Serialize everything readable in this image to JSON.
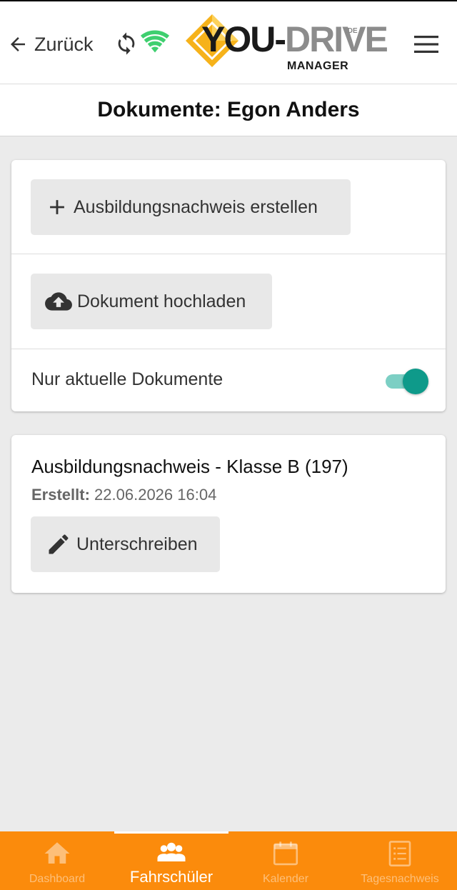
{
  "header": {
    "back_label": "Zurück",
    "logo": {
      "text_you": "YOU-",
      "text_drive": "DRIVE",
      "text_de": ".DE",
      "text_manager": "MANAGER"
    },
    "icons": [
      "arrow-left-icon",
      "sync-icon",
      "wifi-icon",
      "hamburger-menu-icon"
    ]
  },
  "title": "Dokumente: Egon Anders",
  "actions": {
    "create_label": "Ausbildungsnachweis erstellen",
    "upload_label": "Dokument hochladen",
    "toggle_label": "Nur aktuelle Dokumente",
    "toggle_on": true
  },
  "documents": [
    {
      "title": "Ausbildungsnachweis - Klasse B (197)",
      "created_label": "Erstellt:",
      "created_value": "22.06.2026 16:04",
      "sign_label": "Unterschreiben"
    }
  ],
  "bottom_nav": [
    {
      "label": "Dashboard",
      "icon": "home-icon",
      "active": false
    },
    {
      "label": "Fahrschüler",
      "icon": "students-icon",
      "active": true
    },
    {
      "label": "Kalender",
      "icon": "calendar-icon",
      "active": false
    },
    {
      "label": "Tagesnachweis",
      "icon": "list-icon",
      "active": false
    }
  ],
  "colors": {
    "nav_background": "#fb8b0c",
    "toggle_on": "#0e9a8a",
    "wifi": "#3fcf6f",
    "logo_diamond": "#f6b21a"
  }
}
